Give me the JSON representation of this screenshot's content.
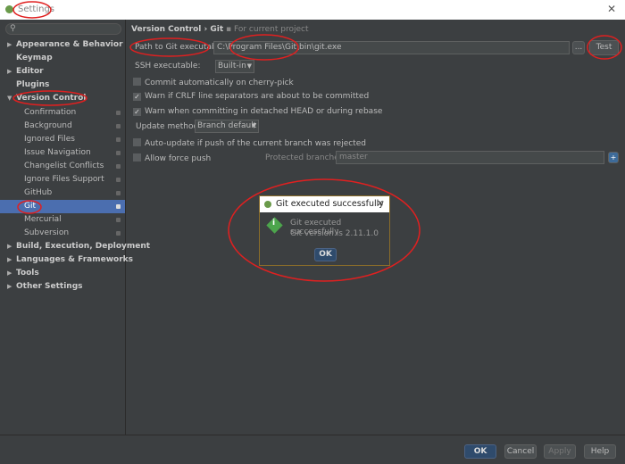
{
  "window": {
    "title": "Settings"
  },
  "sidebar": {
    "search_placeholder": "",
    "items": [
      {
        "label": "Appearance & Behavior"
      },
      {
        "label": "Keymap"
      },
      {
        "label": "Editor"
      },
      {
        "label": "Plugins"
      },
      {
        "label": "Version Control"
      },
      {
        "label": "Confirmation"
      },
      {
        "label": "Background"
      },
      {
        "label": "Ignored Files"
      },
      {
        "label": "Issue Navigation"
      },
      {
        "label": "Changelist Conflicts"
      },
      {
        "label": "Ignore Files Support"
      },
      {
        "label": "GitHub"
      },
      {
        "label": "Git"
      },
      {
        "label": "Mercurial"
      },
      {
        "label": "Subversion"
      },
      {
        "label": "Build, Execution, Deployment"
      },
      {
        "label": "Languages & Frameworks"
      },
      {
        "label": "Tools"
      },
      {
        "label": "Other Settings"
      }
    ]
  },
  "main": {
    "breadcrumb": "Version Control › Git",
    "scope": "For current project",
    "path_label": "Path to Git executable:",
    "path_value": "C:\\Program Files\\Git\\bin\\git.exe",
    "browse": "...",
    "test": "Test",
    "ssh_label": "SSH executable:",
    "ssh_value": "Built-in",
    "commit_auto": "Commit automatically on cherry-pick",
    "warn_crlf": "Warn if CRLF line separators are about to be committed",
    "warn_detached": "Warn when committing in detached HEAD or during rebase",
    "update_label": "Update method:",
    "update_value": "Branch default",
    "auto_update": "Auto-update if push of the current branch was rejected",
    "force_push": "Allow force push",
    "protected_label": "Protected branches:",
    "protected_value": "master"
  },
  "dialog": {
    "title": "Git executed successfully",
    "line1": "Git executed successfully",
    "line2": "Git version is 2.11.1.0",
    "ok": "OK",
    "close": "✕"
  },
  "footer": {
    "ok": "OK",
    "cancel": "Cancel",
    "apply": "Apply",
    "help": "Help"
  }
}
